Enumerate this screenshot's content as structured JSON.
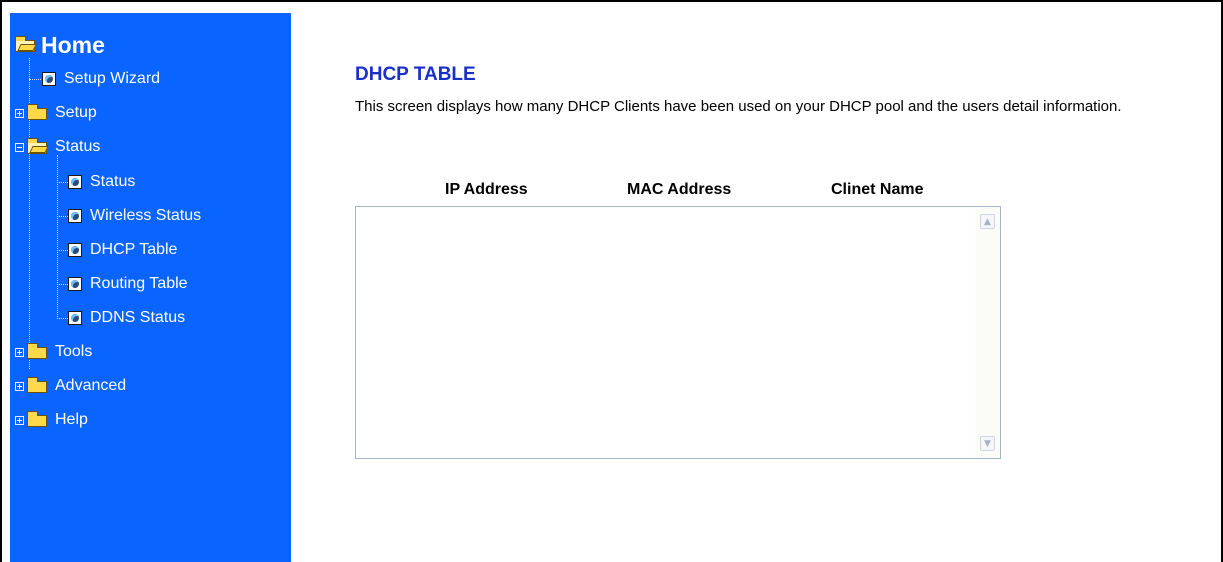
{
  "sidebar": {
    "home": "Home",
    "items": [
      {
        "label": "Setup Wizard"
      },
      {
        "label": "Setup"
      },
      {
        "label": "Status"
      },
      {
        "label": "Status"
      },
      {
        "label": "Wireless Status"
      },
      {
        "label": "DHCP Table"
      },
      {
        "label": "Routing Table"
      },
      {
        "label": "DDNS Status"
      },
      {
        "label": "Tools"
      },
      {
        "label": "Advanced"
      },
      {
        "label": "Help"
      }
    ]
  },
  "main": {
    "title": "DHCP TABLE",
    "description": "This screen displays how many DHCP Clients have been used on your DHCP pool and the users detail information.",
    "table": {
      "columns": [
        "IP Address",
        "MAC Address",
        "Clinet Name"
      ],
      "rows": []
    }
  },
  "colors": {
    "sidebar_bg": "#0a64ff",
    "title": "#1a2fc8"
  },
  "icons": {
    "page": "page-globe-icon",
    "folder_closed": "folder-icon",
    "folder_open": "folder-open-icon",
    "expand": "plus-expander-icon",
    "collapse": "minus-expander-icon",
    "scroll_up": "scroll-up-icon",
    "scroll_down": "scroll-down-icon"
  }
}
